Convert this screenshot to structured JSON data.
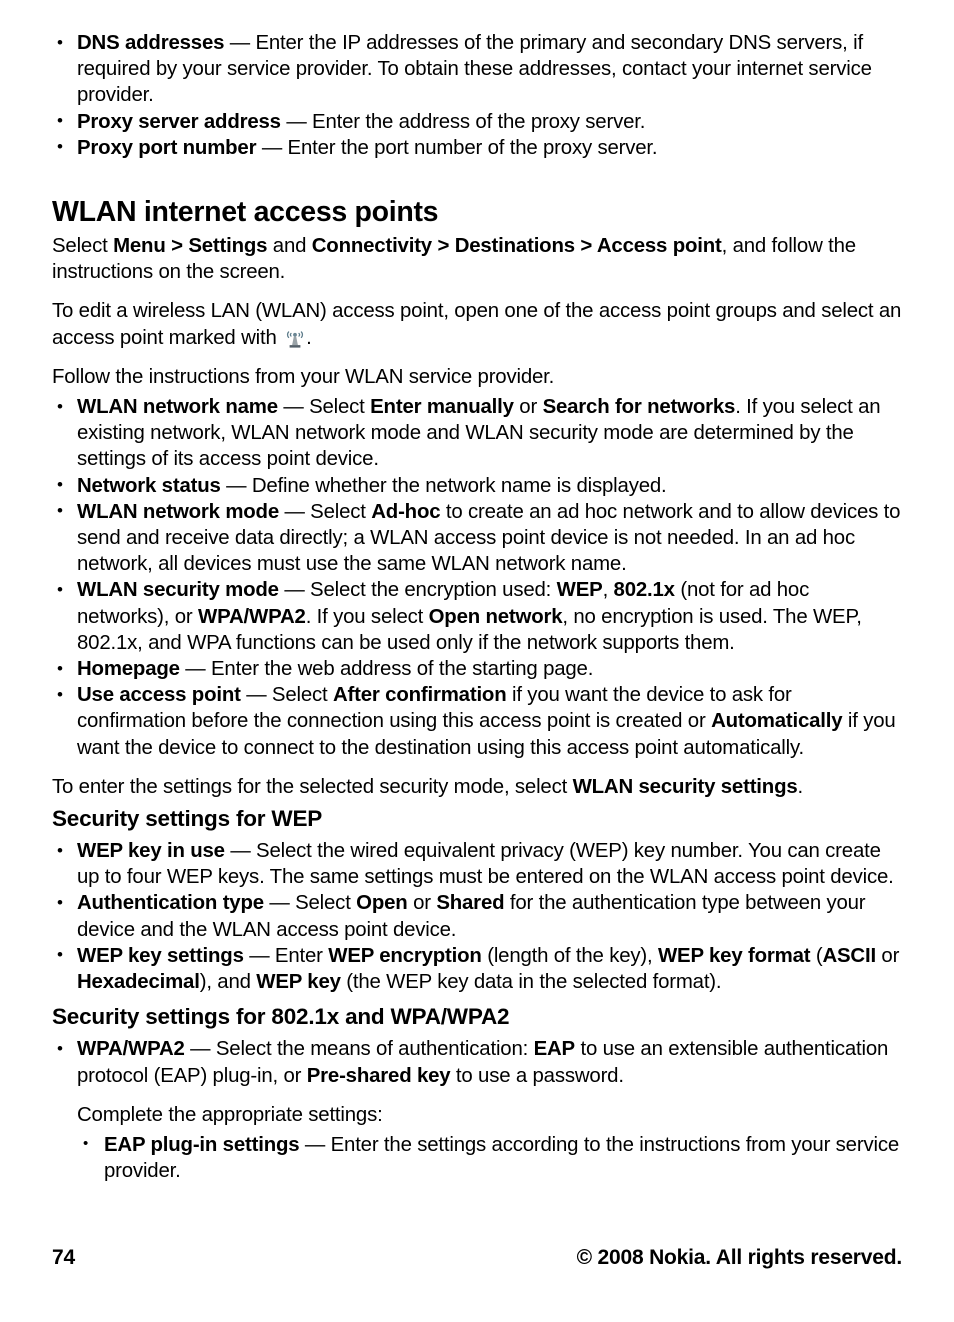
{
  "page": {
    "number": "74",
    "copyright": "© 2008 Nokia. All rights reserved."
  },
  "top_bullets": [
    {
      "term": "DNS addresses",
      "dash": " — ",
      "text": "Enter the IP addresses of the primary and secondary DNS servers, if required by your service provider. To obtain these addresses, contact your internet service provider."
    },
    {
      "term": "Proxy server address",
      "dash": " — ",
      "text": "Enter the address of the proxy server."
    },
    {
      "term": "Proxy port number",
      "dash": " — ",
      "text": "Enter the port number of the proxy server."
    }
  ],
  "section": {
    "heading": "WLAN internet access points",
    "select_path": {
      "lead": "Select ",
      "menu": "Menu",
      "sep1": " > ",
      "settings": "Settings",
      "and": " and ",
      "connectivity": "Connectivity",
      "sep2": " > ",
      "destinations": "Destinations",
      "sep3": " > ",
      "access_point": "Access point",
      "tail": ", and follow the instructions on the screen."
    },
    "edit_intro_part1": "To edit a wireless LAN (WLAN) access point, open one of the access point groups and select an access point marked with ",
    "edit_intro_part2": ".",
    "icon_name": "wlan-access-point-icon",
    "follow_instructions": "Follow the instructions from your WLAN service provider."
  },
  "wlan_bullets": [
    {
      "term": "WLAN network name",
      "dash": " — ",
      "p1": "Select ",
      "b1": "Enter manually",
      "p2": " or ",
      "b2": "Search for networks",
      "p3": ". If you select an existing network, WLAN network mode and WLAN security mode are determined by the settings of its access point device."
    },
    {
      "term": "Network status",
      "dash": " — ",
      "p1": "Define whether the network name is displayed.",
      "b1": "",
      "p2": "",
      "b2": "",
      "p3": ""
    },
    {
      "term": "WLAN network mode",
      "dash": " — ",
      "p1": "Select ",
      "b1": "Ad-hoc",
      "p2": " to create an ad hoc network and to allow devices to send and receive data directly; a WLAN access point device is not needed. In an ad hoc network, all devices must use the same WLAN network name.",
      "b2": "",
      "p3": ""
    },
    {
      "term": "WLAN security mode",
      "dash": " — ",
      "p1": "Select the encryption used: ",
      "b1": "WEP",
      "p2": ", ",
      "b2": "802.1x",
      "p3": " (not for ad hoc networks), or ",
      "b3": "WPA/WPA2",
      "p4": ". If you select ",
      "b4": "Open network",
      "p5": ", no encryption is used. The WEP, 802.1x, and WPA functions can be used only if the network supports them."
    },
    {
      "term": "Homepage",
      "dash": " — ",
      "p1": "Enter the web address of the starting page.",
      "b1": "",
      "p2": "",
      "b2": "",
      "p3": ""
    },
    {
      "term": "Use access point",
      "dash": " — ",
      "p1": "Select ",
      "b1": "After confirmation",
      "p2": " if you want the device to ask for confirmation before the connection using this access point is created or ",
      "b2": "Automatically",
      "p3": " if you want the device to connect to the destination using this access point automatically."
    }
  ],
  "security_intro": {
    "p1": "To enter the settings for the selected security mode, select ",
    "b1": "WLAN security settings",
    "p2": "."
  },
  "wep_section": {
    "heading": "Security settings for WEP",
    "bullets": [
      {
        "term": "WEP key in use",
        "dash": " — ",
        "p1": "Select the wired equivalent privacy (WEP) key number. You can create up to four WEP keys. The same settings must be entered on the WLAN access point device.",
        "b1": "",
        "p2": "",
        "b2": "",
        "p3": "",
        "b3": "",
        "p4": "",
        "b4": "",
        "p5": ""
      },
      {
        "term": "Authentication type",
        "dash": " — ",
        "p1": "Select ",
        "b1": "Open",
        "p2": " or ",
        "b2": "Shared",
        "p3": " for the authentication type between your device and the WLAN access point device.",
        "b3": "",
        "p4": "",
        "b4": "",
        "p5": ""
      },
      {
        "term": "WEP key settings",
        "dash": " — ",
        "p1": "Enter ",
        "b1": "WEP encryption",
        "p2": " (length of the key), ",
        "b2": "WEP key format",
        "p3": " (",
        "b3": "ASCII",
        "p4": " or ",
        "b4": "Hexadecimal",
        "p5": "), and ",
        "b5": "WEP key",
        "p6": " (the WEP key data in the selected format)."
      }
    ]
  },
  "wpa_section": {
    "heading": "Security settings for 802.1x and WPA/WPA2",
    "bullet": {
      "term": "WPA/WPA2",
      "dash": " — ",
      "p1": "Select the means of authentication: ",
      "b1": "EAP",
      "p2": " to use an extensible authentication protocol (EAP) plug-in, or ",
      "b2": "Pre-shared key",
      "p3": " to use a password."
    },
    "complete_note": "Complete the appropriate settings:",
    "nested_bullet": {
      "term": "EAP plug-in settings",
      "dash": " — ",
      "p1": "Enter the settings according to the instructions from your service provider."
    }
  }
}
